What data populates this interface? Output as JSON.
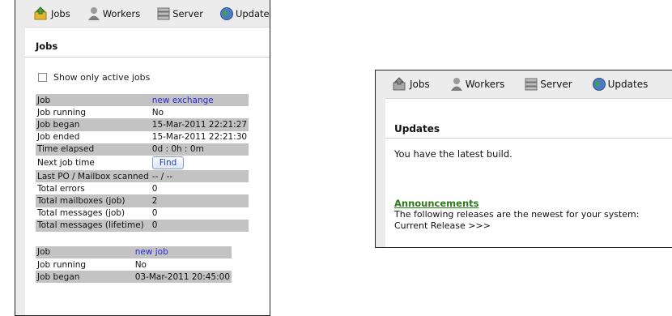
{
  "nav": {
    "jobs": "Jobs",
    "workers": "Workers",
    "server": "Server",
    "updates": "Updates"
  },
  "jobs_page": {
    "title": "Jobs",
    "active_filter_label": "Show only active jobs",
    "job1": {
      "job_label": "Job",
      "job_value": "new exchange",
      "running_label": "Job running",
      "running_value": "No",
      "began_label": "Job began",
      "began_value": "15-Mar-2011 22:21:27",
      "ended_label": "Job ended",
      "ended_value": "15-Mar-2011 22:21:30",
      "elapsed_label": "Time elapsed",
      "elapsed_value": "0d : 0h : 0m",
      "next_label": "Next job time",
      "find_label": "Find",
      "last_label": "Last PO / Mailbox scanned",
      "last_value": "-- / --",
      "errors_label": "Total errors",
      "errors_value": "0",
      "mailboxes_label": "Total mailboxes (job)",
      "mailboxes_value": "2",
      "messages_label": "Total messages (job)",
      "messages_value": "0",
      "lifetime_label": "Total messages (lifetime)",
      "lifetime_value": "0"
    },
    "job2": {
      "job_label": "Job",
      "job_value": "new job",
      "running_label": "Job running",
      "running_value": "No",
      "began_label": "Job began",
      "began_value": "03-Mar-2011 20:45:00"
    }
  },
  "updates_page": {
    "title": "Updates",
    "status": "You have the latest build.",
    "announcements_title": "Announcements",
    "announcements_text": "The following releases are the newest for your system:",
    "current_release": "Current Release >>>"
  },
  "colors": {
    "shaded_row": "#c3c3c3",
    "link": "#2a2ad8",
    "announcement": "#2d7a1c"
  },
  "icons": [
    "jobs-icon",
    "workers-icon",
    "server-icon",
    "updates-icon",
    "checkbox"
  ]
}
